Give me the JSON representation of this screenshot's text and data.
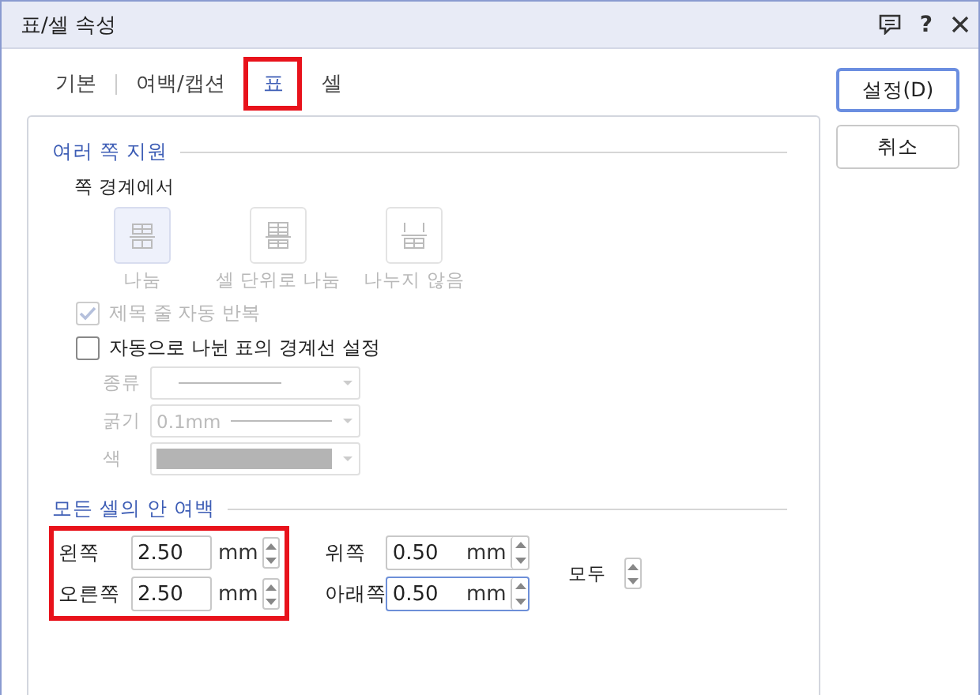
{
  "window": {
    "title": "표/셀 속성",
    "help": "?"
  },
  "tabs": [
    {
      "label": "기본",
      "selected": false,
      "highlighted": false
    },
    {
      "label": "여백/캡션",
      "selected": false,
      "highlighted": false
    },
    {
      "label": "표",
      "selected": true,
      "highlighted": true
    },
    {
      "label": "셀",
      "selected": false,
      "highlighted": false
    }
  ],
  "buttons": [
    {
      "label": "설정(D)",
      "default": true
    },
    {
      "label": "취소",
      "default": false
    }
  ],
  "multi_page": {
    "title": "여러 쪽 지원",
    "subtitle": "쪽 경계에서",
    "disabled": true,
    "options": [
      {
        "label": "나눔",
        "kind": "split",
        "selected": true
      },
      {
        "label": "셀 단위로 나눔",
        "kind": "cell",
        "selected": false
      },
      {
        "label": "나누지 않음",
        "kind": "none",
        "selected": false
      }
    ],
    "checkboxes": [
      {
        "label": "제목 줄 자동 반복",
        "checked": true,
        "disabled": true
      },
      {
        "label": "자동으로 나뉜 표의 경계선 설정",
        "checked": false,
        "disabled": false
      }
    ],
    "border_fields": [
      {
        "label": "종류",
        "kind": "line",
        "disabled": true
      },
      {
        "label": "굵기",
        "kind": "thickness",
        "value": "0.1mm",
        "disabled": true
      },
      {
        "label": "색",
        "kind": "color",
        "disabled": true
      }
    ]
  },
  "margins": {
    "title": "모든 셀의 안 여백",
    "left_highlighted": true,
    "left": [
      {
        "label": "왼쪽",
        "value": "2.50",
        "unit": "mm",
        "focused": false
      },
      {
        "label": "오른쪽",
        "value": "2.50",
        "unit": "mm",
        "focused": false
      }
    ],
    "right": [
      {
        "label": "위쪽",
        "value": "0.50",
        "unit": "mm",
        "focused": false
      },
      {
        "label": "아래쪽",
        "value": "0.50",
        "unit": "mm",
        "focused": true
      }
    ],
    "all": {
      "label": "모두"
    }
  }
}
